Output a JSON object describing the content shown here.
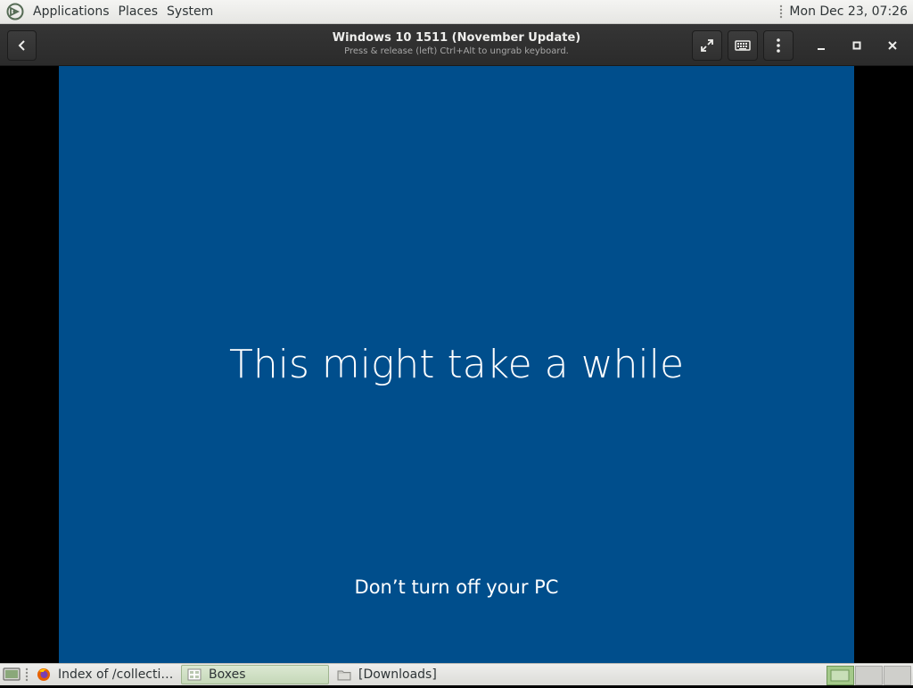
{
  "top_panel": {
    "menus": [
      "Applications",
      "Places",
      "System"
    ],
    "clock": "Mon Dec 23, 07:26"
  },
  "headerbar": {
    "title": "Windows 10 1511 (November Update)",
    "subtitle": "Press & release (left) Ctrl+Alt to ungrab keyboard.",
    "buttons": {
      "back": "back-icon",
      "fullscreen": "fullscreen-icon",
      "keyboard": "keyboard-icon",
      "menu": "vertical-ellipsis-icon",
      "minimize": "minimize-icon",
      "maximize": "maximize-icon",
      "close": "close-icon"
    }
  },
  "vm_screen": {
    "headline": "This might take a while",
    "subline": "Don’t turn off your PC",
    "background": "#004e8c"
  },
  "taskbar": {
    "tasks": [
      {
        "label": "Index of /collection/...",
        "icon": "firefox-icon",
        "active": false
      },
      {
        "label": "Boxes",
        "icon": "boxes-app-icon",
        "active": true
      },
      {
        "label": "[Downloads]",
        "icon": "folder-icon",
        "active": false
      }
    ],
    "workspaces": 3,
    "active_workspace": 1
  },
  "colors": {
    "panel": "#e6e6e3",
    "headerbar": "#2b2b2b",
    "vm_blue": "#004e8c",
    "active_task": "#c5d8b8",
    "active_workspace": "#a4c98a"
  }
}
